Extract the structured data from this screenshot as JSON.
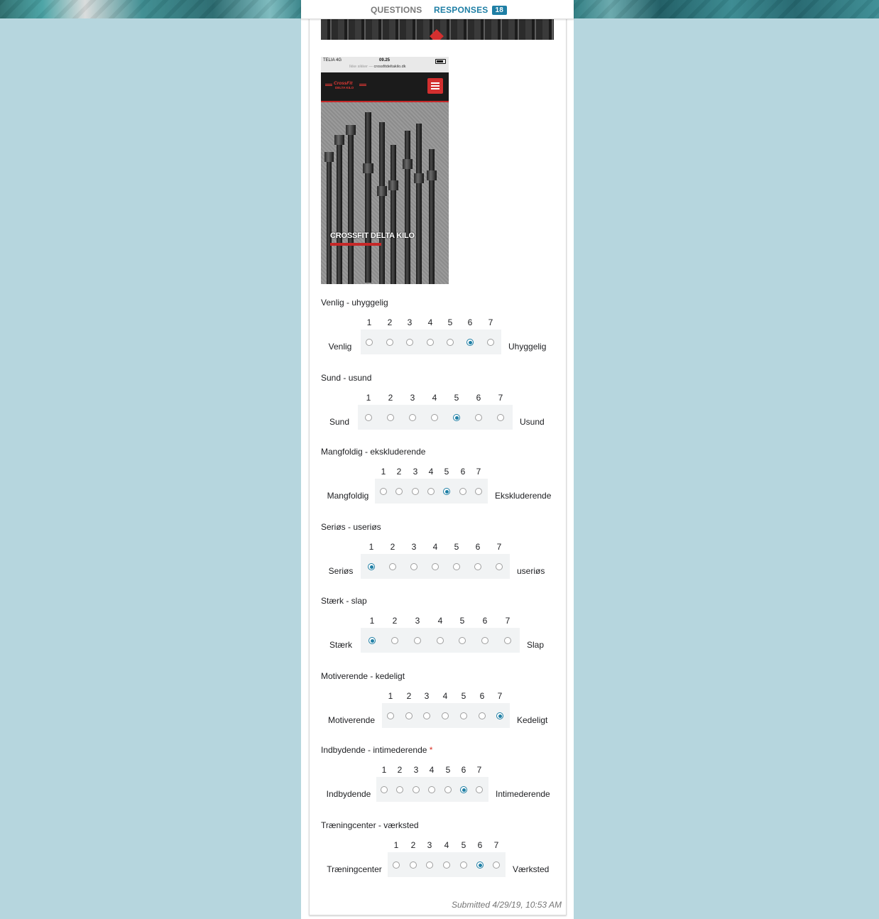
{
  "tabs": {
    "questions": "QUESTIONS",
    "responses": "RESPONSES",
    "responses_count": "18"
  },
  "phone": {
    "carrier": "TELIA  4G",
    "time": "09.25",
    "url_prefix": "Ikke sikker —",
    "url": "crossfitdeltakilo.dk",
    "logo_line1": "CrossFit",
    "logo_line2": "DELTA KILO",
    "hero_title": "CROSSFIT DELTA KILO"
  },
  "scale": [
    "1",
    "2",
    "3",
    "4",
    "5",
    "6",
    "7"
  ],
  "questions": [
    {
      "title": "Venlig - uhyggelig",
      "left": "Venlig",
      "right": "Uhyggelig",
      "selected": 6,
      "required": false
    },
    {
      "title": "Sund - usund",
      "left": "Sund",
      "right": "Usund",
      "selected": 5,
      "required": false
    },
    {
      "title": "Mangfoldig - ekskluderende",
      "left": "Mangfoldig",
      "right": "Ekskluderende",
      "selected": 5,
      "required": false
    },
    {
      "title": "Seriøs - useriøs",
      "left": "Seriøs",
      "right": "useriøs",
      "selected": 1,
      "required": false
    },
    {
      "title": "Stærk - slap",
      "left": "Stærk",
      "right": "Slap",
      "selected": 1,
      "required": false
    },
    {
      "title": "Motiverende - kedeligt",
      "left": "Motiverende",
      "right": "Kedeligt",
      "selected": 7,
      "required": false
    },
    {
      "title": "Indbydende - intimederende",
      "left": "Indbydende",
      "right": "Intimederende",
      "selected": 6,
      "required": true
    },
    {
      "title": "Træningcenter - værksted",
      "left": "Træningcenter",
      "right": "Værksted",
      "selected": 6,
      "required": false
    }
  ],
  "required_marker": "*",
  "submitted": "Submitted 4/29/19, 10:53 AM",
  "colors": {
    "accent": "#1f7fa5",
    "background": "#b6d6de",
    "required": "#d93025"
  }
}
